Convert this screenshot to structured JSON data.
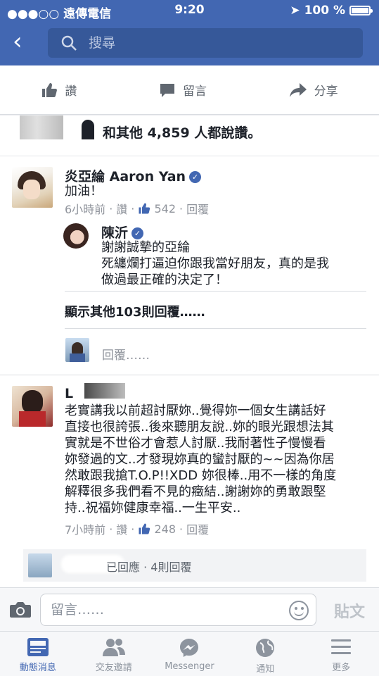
{
  "status_bar": {
    "carrier": "●●●○○ 遠傳電信",
    "time": "9:20",
    "battery": "100 %"
  },
  "search": {
    "placeholder": "搜尋"
  },
  "actions": {
    "like": "讚",
    "comment": "留言",
    "share": "分享"
  },
  "likes_summary": {
    "text": "和其他 4,859 人都說讚。"
  },
  "comments": [
    {
      "author": "炎亞綸 Aaron Yan",
      "verified": true,
      "text": "加油！",
      "time": "6小時前",
      "like_label": "讚",
      "like_count": "542",
      "reply_label": "回覆",
      "replies": [
        {
          "author": "陳沂",
          "verified": true,
          "lines": [
            "謝謝誠摯的亞綸",
            "死纏爛打逼迫你跟我當好朋友，真的是我",
            "做過最正確的決定了！"
          ]
        }
      ],
      "more_replies": "顯示其他103則回覆……",
      "reply_placeholder": "回覆……"
    },
    {
      "author": "L",
      "lines": [
        "老實講我以前超討厭妳..覺得妳一個女生講話好",
        "直接也很誇張..後來聽朋友說..妳的眼光跟想法其",
        "實就是不世俗才會惹人討厭..我耐著性子慢慢看",
        "妳發過的文..才發現妳真的蠻討厭的~~因為你居",
        "然敢跟我搶T.O.P!!XDD  妳很棒..用不一樣的角度",
        "解釋很多我們看不見的癥結..謝謝妳的勇敢跟堅",
        "持..祝福妳健康幸福..一生平安.."
      ],
      "time": "7小時前",
      "like_label": "讚",
      "like_count": "248",
      "reply_label": "回覆",
      "reply_summary": "已回應 · 4則回覆"
    }
  ],
  "composer": {
    "placeholder": "留言……",
    "post": "貼文"
  },
  "tabs": [
    {
      "label": "動態消息",
      "active": true
    },
    {
      "label": "交友邀請",
      "active": false
    },
    {
      "label": "Messenger",
      "active": false
    },
    {
      "label": "通知",
      "active": false
    },
    {
      "label": "更多",
      "active": false
    }
  ]
}
